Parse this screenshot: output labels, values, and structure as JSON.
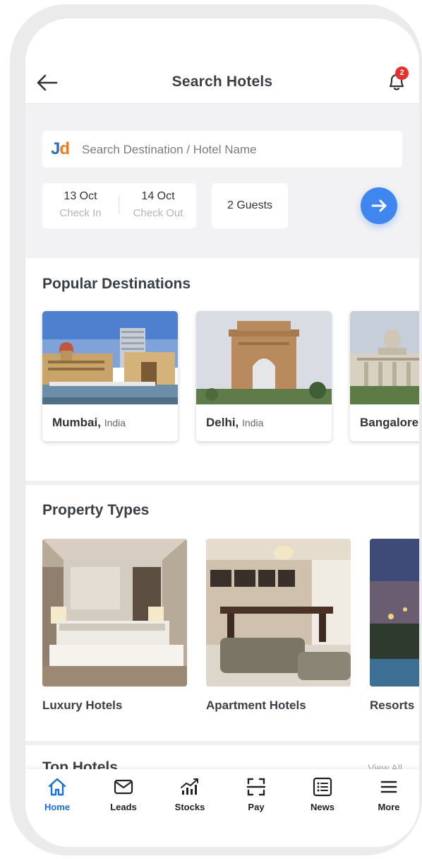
{
  "header": {
    "title": "Search Hotels",
    "notification_count": "2"
  },
  "search": {
    "logo_j": "J",
    "logo_d": "d",
    "placeholder": "Search Destination / Hotel Name",
    "check_in_date": "13 Oct",
    "check_in_label": "Check In",
    "check_out_date": "14 Oct",
    "check_out_label": "Check Out",
    "guests": "2 Guests"
  },
  "popular": {
    "title": "Popular Destinations",
    "items": [
      {
        "city": "Mumbai,",
        "country": "India"
      },
      {
        "city": "Delhi,",
        "country": "India"
      },
      {
        "city": "Bangalore",
        "country": ""
      }
    ]
  },
  "property_types": {
    "title": "Property Types",
    "items": [
      {
        "label": "Luxury Hotels"
      },
      {
        "label": "Apartment Hotels"
      },
      {
        "label": "Resorts"
      }
    ]
  },
  "top_hotels": {
    "title": "Top Hotels",
    "view_all": "View All"
  },
  "bottom_nav": {
    "items": [
      {
        "label": "Home",
        "icon": "home-icon",
        "active": true
      },
      {
        "label": "Leads",
        "icon": "mail-icon"
      },
      {
        "label": "Stocks",
        "icon": "stocks-icon"
      },
      {
        "label": "Pay",
        "icon": "scan-icon"
      },
      {
        "label": "News",
        "icon": "news-icon"
      },
      {
        "label": "More",
        "icon": "menu-icon"
      }
    ]
  },
  "colors": {
    "accent": "#3f86f0",
    "active_nav": "#1a6fd6",
    "badge": "#e3322d",
    "logo_j": "#2d6fbf",
    "logo_d": "#f07a22"
  }
}
